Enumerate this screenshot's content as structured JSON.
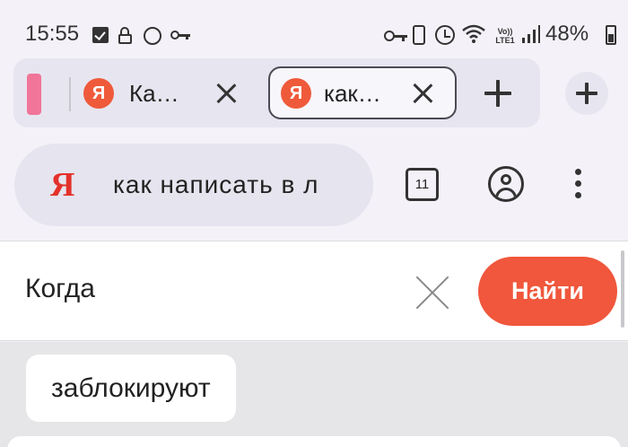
{
  "status_bar": {
    "time": "15:55",
    "network": "Vo)) LTE1",
    "battery": "48%",
    "icons": [
      "check-icon",
      "lock-icon",
      "whatsapp-icon",
      "key-icon",
      "vpn-key-icon",
      "battery-saver-icon",
      "alarm-icon",
      "wifi-icon",
      "signal-icon",
      "battery-icon"
    ]
  },
  "tabs": [
    {
      "favicon": "Я",
      "title": "Ка…"
    },
    {
      "favicon": "Я",
      "title": "как…"
    }
  ],
  "address_bar": {
    "logo": "Я",
    "query": "как написать в л",
    "tab_count": "11"
  },
  "search": {
    "value": "Когда",
    "submit_label": "Найти"
  },
  "suggestions": [
    "заблокируют"
  ],
  "colors": {
    "accent": "#f0573c",
    "group_marker": "#f07599",
    "yandex_red": "#e3312a"
  }
}
